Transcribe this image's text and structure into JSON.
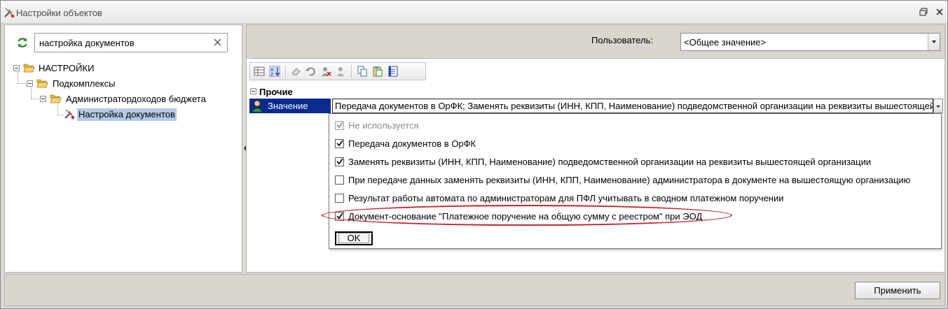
{
  "window": {
    "title": "Настройки объектов",
    "icon": "wrench-screwdriver-icon"
  },
  "left": {
    "search": {
      "value": "настройка документов",
      "placeholder": ""
    },
    "tree": [
      {
        "label": "НАСТРОЙКИ",
        "level": 0,
        "expanded": true
      },
      {
        "label": "Подкомплексы",
        "level": 1,
        "expanded": true
      },
      {
        "label": "Администратордоходов бюджета",
        "level": 2,
        "expanded": true
      },
      {
        "label": "Настройка документов",
        "level": 3,
        "selected": true
      }
    ]
  },
  "right": {
    "user_label": "Пользователь:",
    "user_value": "<Общее значение>",
    "toolbar_icons": [
      "categorized-icon",
      "sort-az-icon",
      "eraser-icon",
      "undo-icon",
      "delete-user-icon",
      "user-icon",
      "copy-icon",
      "paste-icon",
      "notes-icon"
    ],
    "category": "Прочие",
    "property": {
      "name": "Значение",
      "value": "Передача документов в ОрФК; Заменять реквизиты (ИНН, КПП, Наименование) подведомственной организации на реквизиты вышестоящей"
    },
    "options": [
      {
        "label": "Не используется",
        "checked": true,
        "disabled": true
      },
      {
        "label": "Передача документов в ОрФК",
        "checked": true,
        "disabled": false
      },
      {
        "label": "Заменять реквизиты (ИНН, КПП, Наименование) подведомственной организации на реквизиты вышестоящей организации",
        "checked": true,
        "disabled": false
      },
      {
        "label": "При передаче данных заменять реквизиты (ИНН, КПП, Наименование) администратора в документе на вышестоящую организацию",
        "checked": false,
        "disabled": false
      },
      {
        "label": "Результат работы автомата по администраторам для ПФЛ учитывать в сводном платежном поручении",
        "checked": false,
        "disabled": false
      },
      {
        "label": "Документ-основание \"Платежное поручение на общую сумму с реестром\" при ЭОД",
        "checked": true,
        "disabled": false
      }
    ],
    "ok_label": "OK"
  },
  "apply_label": "Применить",
  "colors": {
    "selection": "#0a2a8c",
    "highlight": "#c4262c",
    "tree_selected": "#b4c8e4"
  }
}
